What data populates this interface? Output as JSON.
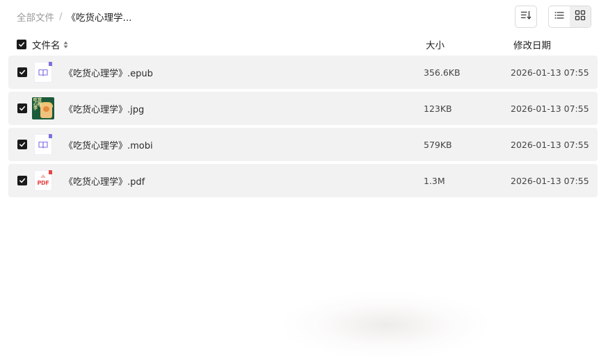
{
  "breadcrumb": {
    "root": "全部文件",
    "separator": "/",
    "current": "《吃货心理学..."
  },
  "toolbar": {
    "sort_icon": "sort-descending-icon",
    "list_view_icon": "list-view-icon",
    "grid_view_icon": "grid-view-icon",
    "active_view": "list"
  },
  "table": {
    "headers": {
      "name": "文件名",
      "size": "大小",
      "date": "修改日期"
    },
    "rows": [
      {
        "name": "《吃货心理学》.epub",
        "size": "356.6KB",
        "date": "2026-01-13 07:55",
        "type": "epub"
      },
      {
        "name": "《吃货心理学》.jpg",
        "size": "123KB",
        "date": "2026-01-13 07:55",
        "type": "jpg"
      },
      {
        "name": "《吃货心理学》.mobi",
        "size": "579KB",
        "date": "2026-01-13 07:55",
        "type": "mobi"
      },
      {
        "name": "《吃货心理学》.pdf",
        "size": "1.3M",
        "date": "2026-01-13 07:55",
        "type": "pdf"
      }
    ]
  },
  "thumbnail_text": {
    "pdf_label": "PDF",
    "jpg_cover_title": "吃货心理学"
  },
  "colors": {
    "row_background": "#f2f2f2",
    "checkbox": "#1a1a1a",
    "ebook_accent": "#7b6fe0",
    "pdf_accent": "#e64545",
    "cover_green": "#1b5b3a"
  }
}
